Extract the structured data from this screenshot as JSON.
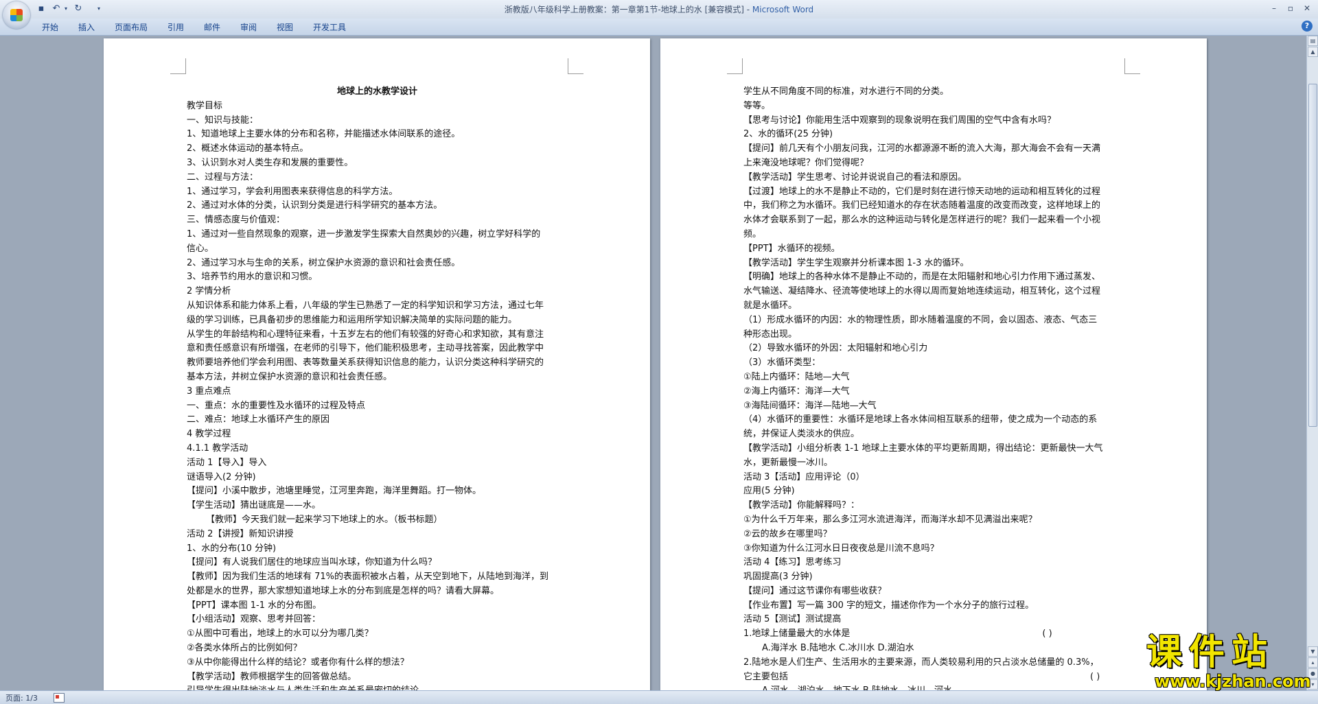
{
  "window": {
    "title": "浙教版八年级科学上册教案：第一章第1节-地球上的水 [兼容模式] - ",
    "app_name": "Microsoft Word"
  },
  "quick_access": {
    "icons": [
      "save-icon",
      "undo-icon",
      "redo-icon",
      "customize-qat-icon"
    ]
  },
  "ribbon": {
    "tabs": [
      "开始",
      "插入",
      "页面布局",
      "引用",
      "邮件",
      "审阅",
      "视图",
      "开发工具"
    ]
  },
  "page1": {
    "lines": [
      "地球上的水教学设计",
      "教学目标",
      "一、知识与技能：",
      "1、知道地球上主要水体的分布和名称，并能描述水体间联系的途径。",
      "2、概述水体运动的基本特点。",
      "3、认识到水对人类生存和发展的重要性。",
      "二、过程与方法：",
      "1、通过学习，学会利用图表来获得信息的科学方法。",
      "2、通过对水体的分类，认识到分类是进行科学研究的基本方法。",
      "三、情感态度与价值观：",
      "1、通过对一些自然现象的观察，进一步激发学生探索大自然奥妙的兴趣，树立学好科学的",
      "信心。",
      "2、通过学习水与生命的关系，树立保护水资源的意识和社会责任感。",
      "3、培养节约用水的意识和习惯。",
      "2 学情分析",
      "从知识体系和能力体系上看，八年级的学生已熟悉了一定的科学知识和学习方法，通过七年",
      "级的学习训练，已具备初步的思维能力和运用所学知识解决简单的实际问题的能力。",
      "从学生的年龄结构和心理特征来看，十五岁左右的他们有较强的好奇心和求知欲，其有意注",
      "意和责任感意识有所增强，在老师的引导下，他们能积极思考，主动寻找答案，因此教学中",
      "教师要培养他们学会利用图、表等数量关系获得知识信息的能力，认识分类这种科学研究的",
      "基本方法，并树立保护水资源的意识和社会责任感。",
      "3 重点难点",
      "一、重点：水的重要性及水循环的过程及特点",
      "二、难点：地球上水循环产生的原因",
      "4 教学过程",
      "4.1.1 教学活动",
      "活动 1【导入】导入",
      "谜语导入(2 分钟)",
      "【提问】小溪中散步，池塘里睡觉，江河里奔跑，海洋里舞蹈。打一物体。",
      "【学生活动】猜出谜底是——水。",
      "【教师】今天我们就一起来学习下地球上的水。（板书标题）",
      "活动 2【讲授】新知识讲授",
      "1、水的分布(10 分钟)",
      "【提问】有人说我们居住的地球应当叫水球，你知道为什么吗？",
      "【教师】因为我们生活的地球有 71%的表面积被水占着，从天空到地下，从陆地到海洋，到",
      "处都是水的世界，那大家想知道地球上水的分布到底是怎样的吗？请看大屏幕。",
      "【PPT】课本图 1-1 水的分布图。",
      "【小组活动】观察、思考并回答：",
      "①从图中可看出，地球上的水可以分为哪几类？",
      "②各类水体所占的比例如何？",
      "③从中你能得出什么样的结论？或者你有什么样的想法？",
      "【教学活动】教师根据学生的回答做总结。",
      "引导学生得出陆地淡水与人类生活和生产关系最密切的结论"
    ]
  },
  "page2": {
    "lines": [
      "学生从不同角度不同的标准，对水进行不同的分类。",
      "等等。",
      "【思考与讨论】你能用生活中观察到的现象说明在我们周围的空气中含有水吗？",
      "2、水的循环(25 分钟)",
      "【提问】前几天有个小朋友问我，江河的水都源源不断的流入大海，那大海会不会有一天满",
      "上来淹没地球呢？你们觉得呢？",
      "【教学活动】学生思考、讨论并说说自己的看法和原因。",
      "【过渡】地球上的水不是静止不动的，它们是时刻在进行惊天动地的运动和相互转化的过程",
      "中，我们称之为水循环。我们已经知道水的存在状态随着温度的改变而改变，这样地球上的",
      "水体才会联系到了一起，那么水的这种运动与转化是怎样进行的呢？我们一起来看一个小视",
      "频。",
      "【PPT】水循环的视频。",
      "【教学活动】学生学生观察并分析课本图 1-3 水的循环。",
      "【明确】地球上的各种水体不是静止不动的，而是在太阳辐射和地心引力作用下通过蒸发、",
      "水气输送、凝结降水、径流等使地球上的水得以周而复始地连续运动，相互转化，这个过程",
      "就是水循环。",
      "（1）形成水循环的内因：水的物理性质，即水随着温度的不同，会以固态、液态、气态三",
      "种形态出现。",
      "（2）导致水循环的外因：太阳辐射和地心引力",
      "（3）水循环类型：",
      "①陆上内循环：陆地—大气",
      "②海上内循环：海洋—大气",
      "③海陆间循环：海洋—陆地—大气",
      "（4）水循环的重要性：水循环是地球上各水体间相互联系的纽带，使之成为一个动态的系",
      "统，并保证人类淡水的供应。",
      "【教学活动】小组分析表 1-1 地球上主要水体的平均更新周期，得出结论：更新最快一大气",
      "水，更新最慢一冰川。",
      "活动 3【活动】应用评论（0）",
      "应用(5 分钟)",
      "【教学活动】你能解释吗？：",
      "①为什么千万年来，那么多江河水流进海洋，而海洋水却不见满溢出来呢？",
      "②云的故乡在哪里吗？",
      "③你知道为什么江河水日日夜夜总是川流不息吗？",
      "活动 4【练习】思考练习",
      "巩固提高(3 分钟)",
      "【提问】通过这节课你有哪些收获？",
      "【作业布置】写一篇 300 字的短文，描述你作为一个水分子的旅行过程。",
      "活动 5【测试】测试提高",
      "1.地球上储量最大的水体是",
      "A.海洋水      B.陆地水      C.冰川水      D.湖泊水",
      "2.陆地水是人们生产、生活用水的主要来源，而人类较易利用的只占淡水总储量的  0.3%，",
      "它主要包括",
      "A.河水、湖泊水、地下水    B.陆地水、冰川、河水"
    ],
    "answer_brackets": [
      "(      )",
      "(      )"
    ]
  },
  "status_bar": {
    "page_label": "页面: 1/3"
  },
  "watermark": {
    "logo": "课件站",
    "url": "www.kjzhan.com"
  }
}
